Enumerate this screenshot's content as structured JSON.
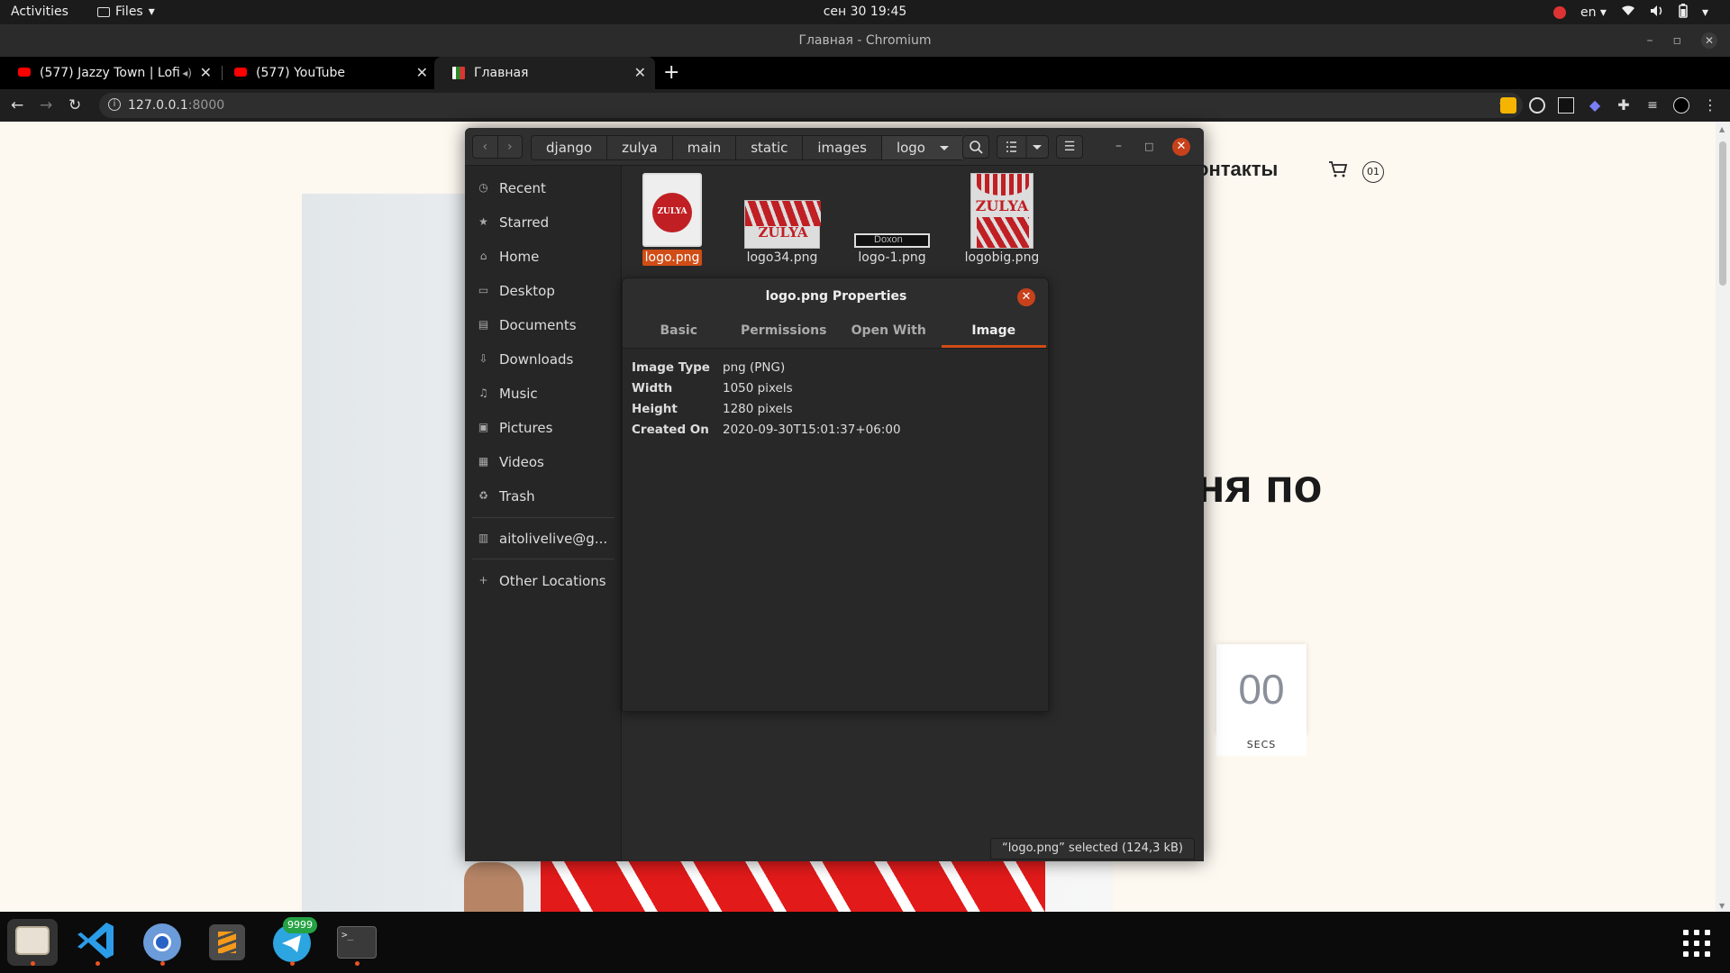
{
  "topbar": {
    "activities": "Activities",
    "app_menu": "Files",
    "clock": "сен 30  19:45",
    "lang": "en"
  },
  "chrome": {
    "window_title": "Главная - Chromium",
    "tabs": [
      {
        "title": "(577) Jazzy Town | Lofi",
        "favicon": "youtube-icon",
        "active": false
      },
      {
        "title": "(577) YouTube",
        "favicon": "youtube-icon",
        "active": false
      },
      {
        "title": "Главная",
        "favicon": "site-favicon",
        "active": true
      }
    ],
    "new_tab": "+",
    "url_host": "127.0.0.1",
    "url_port": ":8000"
  },
  "webpage": {
    "nav_contacts": "онтакты",
    "cart_count": "01",
    "hero_title": "ня по",
    "countdown_value": "00",
    "countdown_label": "SECS"
  },
  "files": {
    "breadcrumbs": [
      "django",
      "zulya",
      "main",
      "static",
      "images",
      "logo"
    ],
    "sidebar": [
      {
        "label": "Recent",
        "icon": "clock-icon"
      },
      {
        "label": "Starred",
        "icon": "star-icon"
      },
      {
        "label": "Home",
        "icon": "home-icon"
      },
      {
        "label": "Desktop",
        "icon": "desktop-icon"
      },
      {
        "label": "Documents",
        "icon": "documents-icon"
      },
      {
        "label": "Downloads",
        "icon": "download-icon"
      },
      {
        "label": "Music",
        "icon": "music-icon"
      },
      {
        "label": "Pictures",
        "icon": "pictures-icon"
      },
      {
        "label": "Videos",
        "icon": "videos-icon"
      },
      {
        "label": "Trash",
        "icon": "trash-icon"
      },
      {
        "label": "aitolivelive@g...",
        "icon": "network-drive-icon"
      },
      {
        "label": "Other Locations",
        "icon": "plus-icon"
      }
    ],
    "items": [
      {
        "name": "logo.png",
        "selected": true
      },
      {
        "name": "logo34.png",
        "selected": false
      },
      {
        "name": "logo-1.png",
        "selected": false
      },
      {
        "name": "logobig.png",
        "selected": false
      }
    ],
    "thumb_text_zulya": "ZULYA",
    "thumb_text_doxon": "Doxon",
    "status": "“logo.png” selected  (124,3 kB)"
  },
  "properties": {
    "title": "logo.png Properties",
    "tabs": [
      "Basic",
      "Permissions",
      "Open With",
      "Image"
    ],
    "active_tab": "Image",
    "rows": [
      {
        "key": "Image Type",
        "value": "png (PNG)"
      },
      {
        "key": "Width",
        "value": "1050 pixels"
      },
      {
        "key": "Height",
        "value": "1280 pixels"
      },
      {
        "key": "Created On",
        "value": "2020-09-30T15:01:37+06:00"
      }
    ]
  },
  "dock": {
    "apps": [
      "files-icon",
      "vscode-icon",
      "chromium-icon",
      "sublime-text-icon",
      "telegram-icon",
      "terminal-icon"
    ],
    "telegram_badge": "9999"
  },
  "colors": {
    "accent": "#d04d16",
    "close_button": "#c7411b",
    "brand_red": "#e21a1a"
  }
}
